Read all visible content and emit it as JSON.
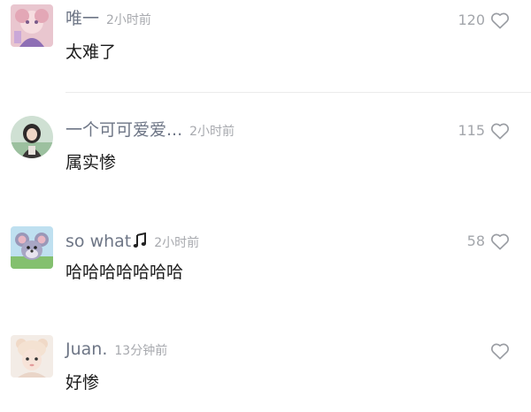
{
  "comments": [
    {
      "username": "唯一",
      "time": "2小时前",
      "text": "太难了",
      "likes": "120",
      "avatar": "avatar-anime-girl"
    },
    {
      "username": "一个可可爱爱...",
      "time": "2小时前",
      "text": "属实惨",
      "likes": "115",
      "avatar": "avatar-girl-round"
    },
    {
      "username": "so what",
      "username_icon": "music-note-icon",
      "time": "2小时前",
      "text": "哈哈哈哈哈哈哈",
      "likes": "58",
      "avatar": "avatar-cartoon-mouse"
    },
    {
      "username": "Juan.",
      "time": "13分钟前",
      "text": "好惨",
      "likes": "",
      "avatar": "avatar-girl-bear-hat"
    }
  ],
  "colors": {
    "username": "#6e7686",
    "timestamp": "#a7a9ae",
    "text": "#1c1c1c",
    "likes": "#a3a6ab"
  }
}
